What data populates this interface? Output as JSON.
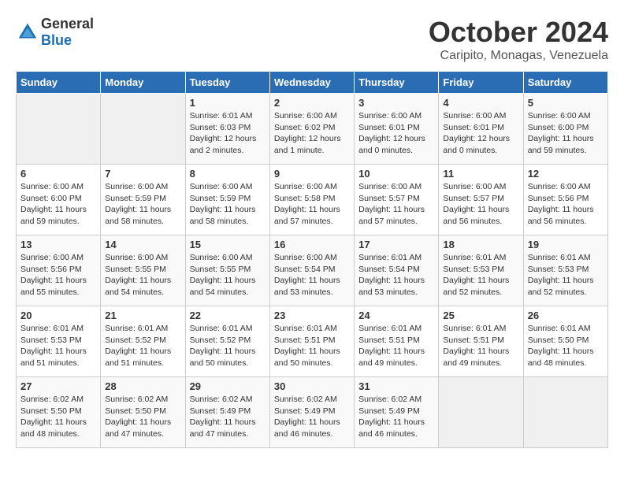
{
  "header": {
    "logo": {
      "text_general": "General",
      "text_blue": "Blue"
    },
    "title": "October 2024",
    "subtitle": "Caripito, Monagas, Venezuela"
  },
  "days_of_week": [
    "Sunday",
    "Monday",
    "Tuesday",
    "Wednesday",
    "Thursday",
    "Friday",
    "Saturday"
  ],
  "weeks": [
    [
      {
        "day": "",
        "info": ""
      },
      {
        "day": "",
        "info": ""
      },
      {
        "day": "1",
        "info": "Sunrise: 6:01 AM\nSunset: 6:03 PM\nDaylight: 12 hours\nand 2 minutes."
      },
      {
        "day": "2",
        "info": "Sunrise: 6:00 AM\nSunset: 6:02 PM\nDaylight: 12 hours\nand 1 minute."
      },
      {
        "day": "3",
        "info": "Sunrise: 6:00 AM\nSunset: 6:01 PM\nDaylight: 12 hours\nand 0 minutes."
      },
      {
        "day": "4",
        "info": "Sunrise: 6:00 AM\nSunset: 6:01 PM\nDaylight: 12 hours\nand 0 minutes."
      },
      {
        "day": "5",
        "info": "Sunrise: 6:00 AM\nSunset: 6:00 PM\nDaylight: 11 hours\nand 59 minutes."
      }
    ],
    [
      {
        "day": "6",
        "info": "Sunrise: 6:00 AM\nSunset: 6:00 PM\nDaylight: 11 hours\nand 59 minutes."
      },
      {
        "day": "7",
        "info": "Sunrise: 6:00 AM\nSunset: 5:59 PM\nDaylight: 11 hours\nand 58 minutes."
      },
      {
        "day": "8",
        "info": "Sunrise: 6:00 AM\nSunset: 5:59 PM\nDaylight: 11 hours\nand 58 minutes."
      },
      {
        "day": "9",
        "info": "Sunrise: 6:00 AM\nSunset: 5:58 PM\nDaylight: 11 hours\nand 57 minutes."
      },
      {
        "day": "10",
        "info": "Sunrise: 6:00 AM\nSunset: 5:57 PM\nDaylight: 11 hours\nand 57 minutes."
      },
      {
        "day": "11",
        "info": "Sunrise: 6:00 AM\nSunset: 5:57 PM\nDaylight: 11 hours\nand 56 minutes."
      },
      {
        "day": "12",
        "info": "Sunrise: 6:00 AM\nSunset: 5:56 PM\nDaylight: 11 hours\nand 56 minutes."
      }
    ],
    [
      {
        "day": "13",
        "info": "Sunrise: 6:00 AM\nSunset: 5:56 PM\nDaylight: 11 hours\nand 55 minutes."
      },
      {
        "day": "14",
        "info": "Sunrise: 6:00 AM\nSunset: 5:55 PM\nDaylight: 11 hours\nand 54 minutes."
      },
      {
        "day": "15",
        "info": "Sunrise: 6:00 AM\nSunset: 5:55 PM\nDaylight: 11 hours\nand 54 minutes."
      },
      {
        "day": "16",
        "info": "Sunrise: 6:00 AM\nSunset: 5:54 PM\nDaylight: 11 hours\nand 53 minutes."
      },
      {
        "day": "17",
        "info": "Sunrise: 6:01 AM\nSunset: 5:54 PM\nDaylight: 11 hours\nand 53 minutes."
      },
      {
        "day": "18",
        "info": "Sunrise: 6:01 AM\nSunset: 5:53 PM\nDaylight: 11 hours\nand 52 minutes."
      },
      {
        "day": "19",
        "info": "Sunrise: 6:01 AM\nSunset: 5:53 PM\nDaylight: 11 hours\nand 52 minutes."
      }
    ],
    [
      {
        "day": "20",
        "info": "Sunrise: 6:01 AM\nSunset: 5:53 PM\nDaylight: 11 hours\nand 51 minutes."
      },
      {
        "day": "21",
        "info": "Sunrise: 6:01 AM\nSunset: 5:52 PM\nDaylight: 11 hours\nand 51 minutes."
      },
      {
        "day": "22",
        "info": "Sunrise: 6:01 AM\nSunset: 5:52 PM\nDaylight: 11 hours\nand 50 minutes."
      },
      {
        "day": "23",
        "info": "Sunrise: 6:01 AM\nSunset: 5:51 PM\nDaylight: 11 hours\nand 50 minutes."
      },
      {
        "day": "24",
        "info": "Sunrise: 6:01 AM\nSunset: 5:51 PM\nDaylight: 11 hours\nand 49 minutes."
      },
      {
        "day": "25",
        "info": "Sunrise: 6:01 AM\nSunset: 5:51 PM\nDaylight: 11 hours\nand 49 minutes."
      },
      {
        "day": "26",
        "info": "Sunrise: 6:01 AM\nSunset: 5:50 PM\nDaylight: 11 hours\nand 48 minutes."
      }
    ],
    [
      {
        "day": "27",
        "info": "Sunrise: 6:02 AM\nSunset: 5:50 PM\nDaylight: 11 hours\nand 48 minutes."
      },
      {
        "day": "28",
        "info": "Sunrise: 6:02 AM\nSunset: 5:50 PM\nDaylight: 11 hours\nand 47 minutes."
      },
      {
        "day": "29",
        "info": "Sunrise: 6:02 AM\nSunset: 5:49 PM\nDaylight: 11 hours\nand 47 minutes."
      },
      {
        "day": "30",
        "info": "Sunrise: 6:02 AM\nSunset: 5:49 PM\nDaylight: 11 hours\nand 46 minutes."
      },
      {
        "day": "31",
        "info": "Sunrise: 6:02 AM\nSunset: 5:49 PM\nDaylight: 11 hours\nand 46 minutes."
      },
      {
        "day": "",
        "info": ""
      },
      {
        "day": "",
        "info": ""
      }
    ]
  ]
}
